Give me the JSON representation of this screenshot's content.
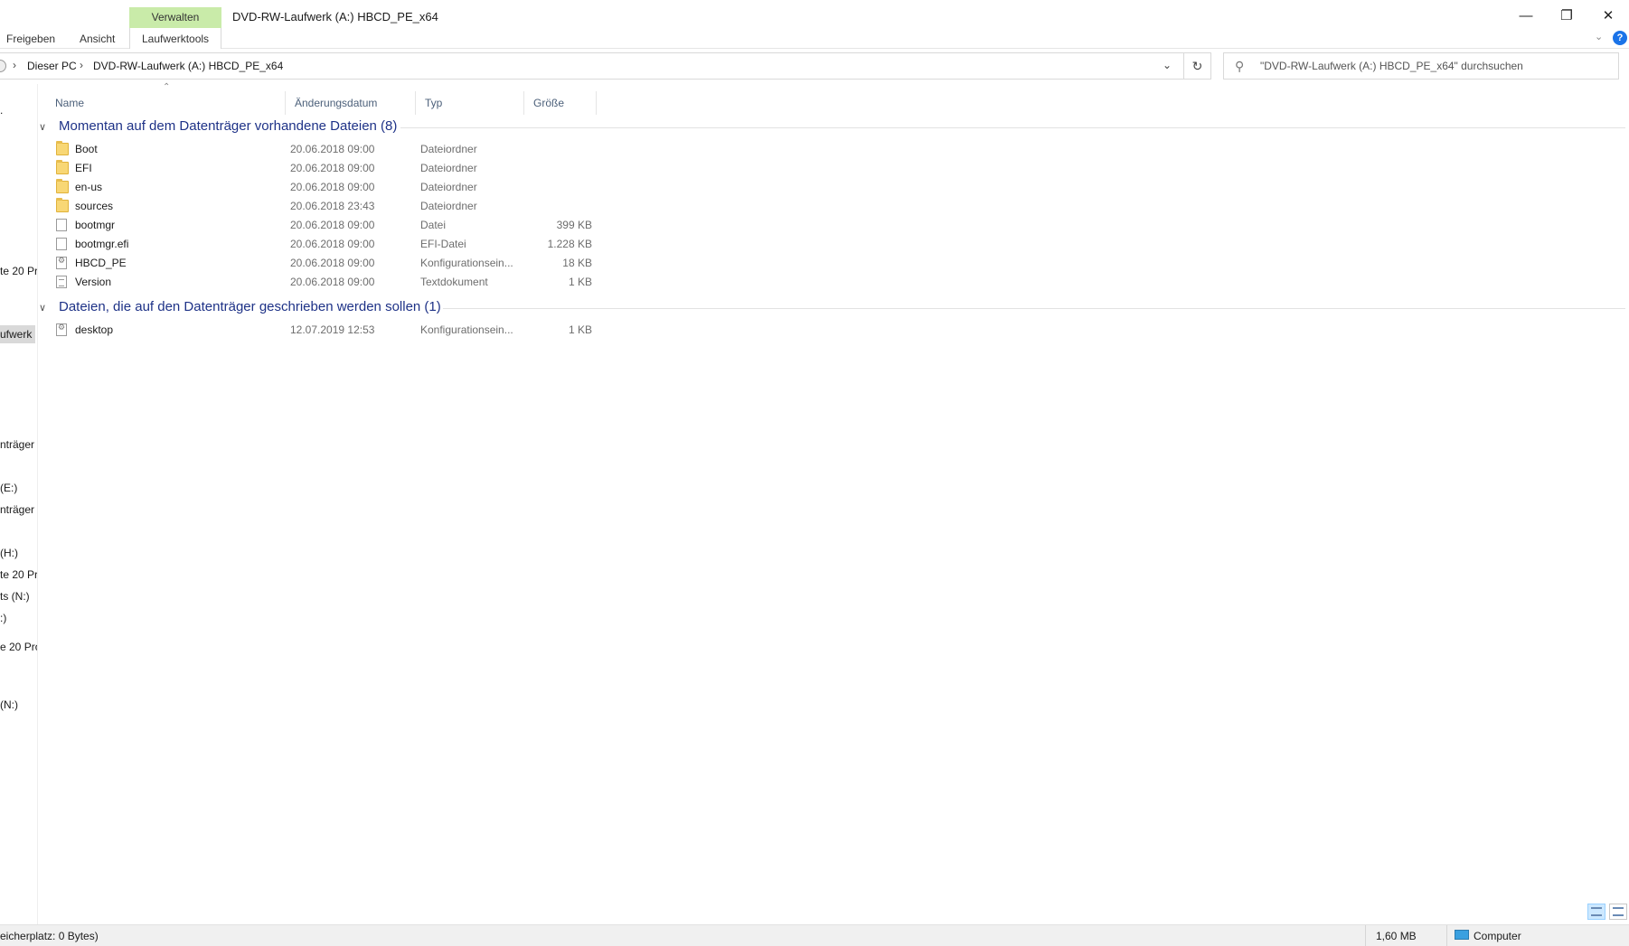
{
  "window": {
    "title": "DVD-RW-Laufwerk (A:) HBCD_PE_x64",
    "context_group": "Verwalten",
    "tabs": [
      "Freigeben",
      "Ansicht",
      "Laufwerktools"
    ],
    "controls": {
      "minimize": "—",
      "maximize": "❐",
      "close": "✕"
    },
    "help": "?"
  },
  "address": {
    "crumbs": [
      "Dieser PC",
      "DVD-RW-Laufwerk (A:) HBCD_PE_x64"
    ],
    "search_placeholder": "\"DVD-RW-Laufwerk (A:) HBCD_PE_x64\" durchsuchen"
  },
  "nav": {
    "items": [
      ".",
      "te 20 Pr",
      "ufwerk",
      "nträger",
      "(E:)",
      "nträger",
      "(H:)",
      "te 20 Pr",
      "ts (N:)",
      ":)",
      "e 20 Pro",
      "(N:)"
    ]
  },
  "columns": {
    "name": "Name",
    "date": "Änderungsdatum",
    "type": "Typ",
    "size": "Größe"
  },
  "groups": [
    {
      "title": "Momentan auf dem Datenträger vorhandene Dateien (8)",
      "files": [
        {
          "name": "Boot",
          "date": "20.06.2018 09:00",
          "type": "Dateiordner",
          "size": "",
          "icon": "folder-icon"
        },
        {
          "name": "EFI",
          "date": "20.06.2018 09:00",
          "type": "Dateiordner",
          "size": "",
          "icon": "folder-icon"
        },
        {
          "name": "en-us",
          "date": "20.06.2018 09:00",
          "type": "Dateiordner",
          "size": "",
          "icon": "folder-icon"
        },
        {
          "name": "sources",
          "date": "20.06.2018 23:43",
          "type": "Dateiordner",
          "size": "",
          "icon": "folder-icon"
        },
        {
          "name": "bootmgr",
          "date": "20.06.2018 09:00",
          "type": "Datei",
          "size": "399 KB",
          "icon": "file-icon"
        },
        {
          "name": "bootmgr.efi",
          "date": "20.06.2018 09:00",
          "type": "EFI-Datei",
          "size": "1.228 KB",
          "icon": "file-icon"
        },
        {
          "name": "HBCD_PE",
          "date": "20.06.2018 09:00",
          "type": "Konfigurationsein...",
          "size": "18 KB",
          "icon": "config-file-icon"
        },
        {
          "name": "Version",
          "date": "20.06.2018 09:00",
          "type": "Textdokument",
          "size": "1 KB",
          "icon": "text-file-icon"
        }
      ]
    },
    {
      "title": "Dateien, die auf den Datenträger geschrieben werden sollen (1)",
      "files": [
        {
          "name": "desktop",
          "date": "12.07.2019 12:53",
          "type": "Konfigurationsein...",
          "size": "1 KB",
          "icon": "config-file-icon"
        }
      ]
    }
  ],
  "status": {
    "free_space": "eicherplatz: 0 Bytes)",
    "size": "1,60 MB",
    "location": "Computer"
  }
}
